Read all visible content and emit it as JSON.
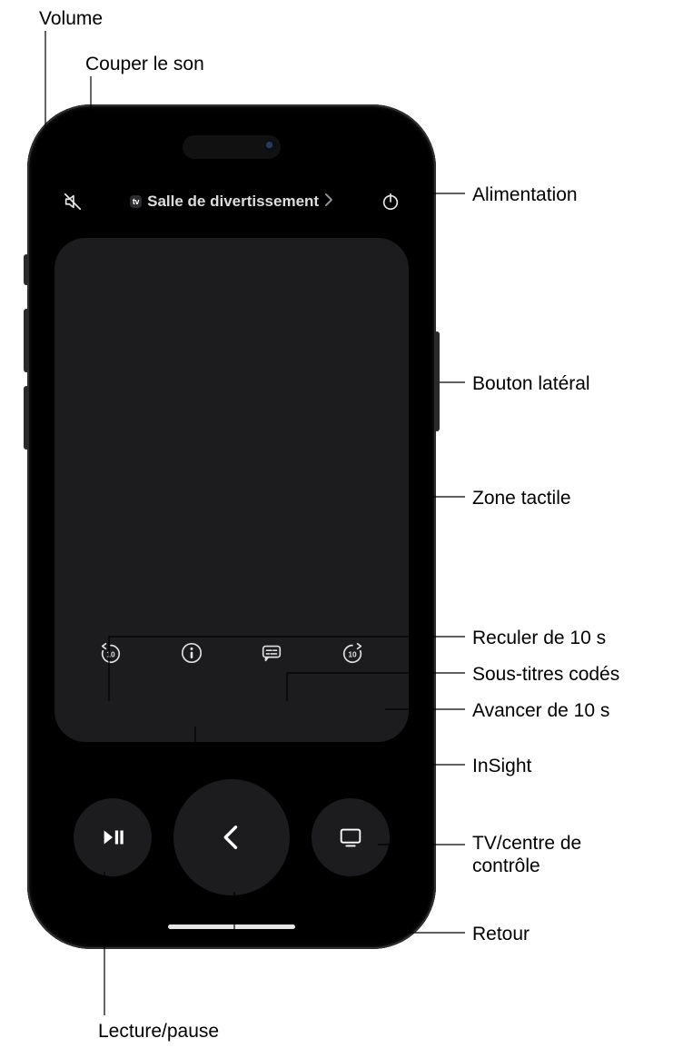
{
  "callouts": {
    "volume": "Volume",
    "mute": "Couper le son",
    "power": "Alimentation",
    "side_button": "Bouton latéral",
    "touch_area": "Zone tactile",
    "skip_back": "Reculer de 10 s",
    "closed_captions": "Sous-titres codés",
    "skip_fwd": "Avancer de 10 s",
    "insight": "InSight",
    "tv_control": "TV/centre de contrôle",
    "back": "Retour",
    "play_pause": "Lecture/pause"
  },
  "header": {
    "device_badge": "tv",
    "title": "Salle de divertissement"
  },
  "mid_row": {
    "skip_back_seconds": "10",
    "skip_fwd_seconds": "10"
  }
}
